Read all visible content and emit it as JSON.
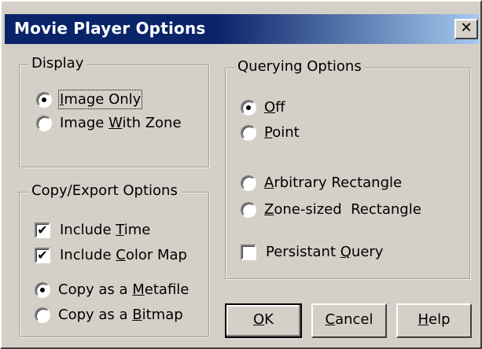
{
  "window": {
    "title": "Movie Player Options",
    "close_symbol": "✕"
  },
  "display": {
    "legend": "Display",
    "options": [
      {
        "pre": "",
        "u": "I",
        "post": "mage Only",
        "selected": true
      },
      {
        "pre": "Image ",
        "u": "W",
        "post": "ith Zone",
        "selected": false
      }
    ]
  },
  "copy_export": {
    "legend": "Copy/Export Options",
    "checks": [
      {
        "pre": "Include ",
        "u": "T",
        "post": "ime",
        "checked": true
      },
      {
        "pre": "Include ",
        "u": "C",
        "post": "olor Map",
        "checked": true
      }
    ],
    "options": [
      {
        "pre": "Copy as a ",
        "u": "M",
        "post": "etafile",
        "selected": true
      },
      {
        "pre": "Copy as a ",
        "u": "B",
        "post": "itmap",
        "selected": false
      }
    ]
  },
  "querying": {
    "legend": "Querying Options",
    "options": [
      {
        "pre": "",
        "u": "O",
        "post": "ff",
        "selected": true
      },
      {
        "pre": "",
        "u": "P",
        "post": "oint",
        "selected": false
      },
      {
        "pre": "",
        "u": "A",
        "post": "rbitrary Rectangle",
        "selected": false
      },
      {
        "pre": "",
        "u": "Z",
        "post": "one-sized  Rectangle",
        "selected": false
      }
    ],
    "persistant": {
      "pre": "Persistant ",
      "u": "Q",
      "post": "uery",
      "checked": false
    }
  },
  "buttons": {
    "ok": {
      "pre": "",
      "u": "O",
      "post": "K"
    },
    "cancel": {
      "pre": "",
      "u": "C",
      "post": "ancel"
    },
    "help": {
      "pre": "",
      "u": "H",
      "post": "elp"
    }
  },
  "check_mark": "✔"
}
